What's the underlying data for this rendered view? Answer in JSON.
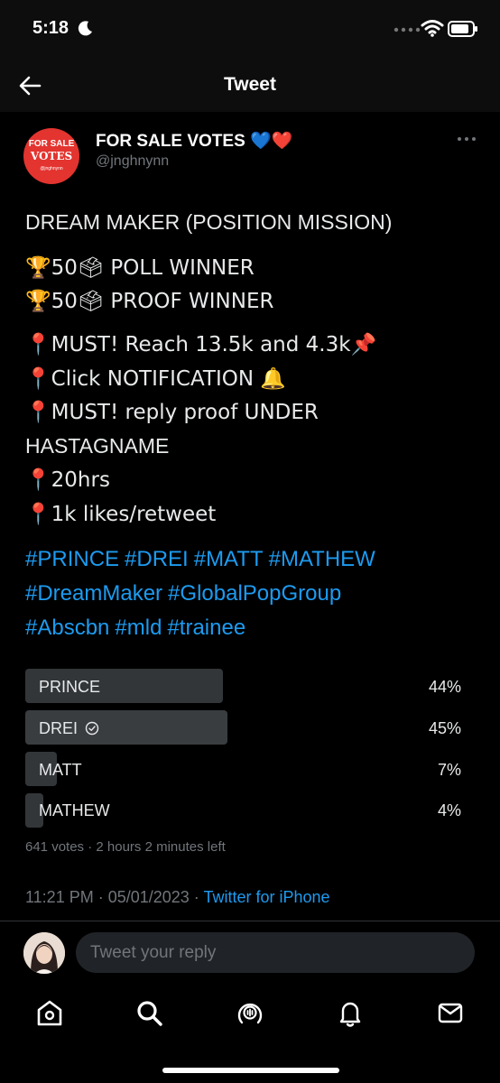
{
  "status_bar": {
    "time": "5:18"
  },
  "header": {
    "title": "Tweet"
  },
  "author": {
    "display_name": "FOR SALE VOTES 💙❤️",
    "handle": "@jnghnynn",
    "avatar_top": "FOR SALE",
    "avatar_main": "VOTES",
    "avatar_sub": "@jnghnynn"
  },
  "tweet": {
    "lines": [
      "DREAM MAKER (POSITION MISSION)",
      "🏆50🗳 POLL WINNER",
      "🏆50🗳 PROOF WINNER",
      "📍MUST! Reach 13.5k and 4.3k📌",
      "📍Click NOTIFICATION 🔔",
      "📍MUST! reply proof UNDER",
      "HASTAGNAME",
      "📍20hrs",
      "📍1k likes/retweet"
    ],
    "hashtags_line1": [
      "#PRINCE",
      "#DREI",
      "#MATT",
      "#MATHEW"
    ],
    "hashtags_line2": [
      "#DreamMaker",
      "#GlobalPopGroup"
    ],
    "hashtags_line3": [
      "#Abscbn",
      "#mld",
      "#trainee"
    ]
  },
  "poll": {
    "options": [
      {
        "label": "PRINCE",
        "percent": "44%",
        "value": 44
      },
      {
        "label": "DREI",
        "percent": "45%",
        "value": 45,
        "winner": true
      },
      {
        "label": "MATT",
        "percent": "7%",
        "value": 7
      },
      {
        "label": "MATHEW",
        "percent": "4%",
        "value": 4
      }
    ],
    "meta": "641 votes · 2 hours 2 minutes left"
  },
  "tweet_meta": {
    "time_date": "11:21 PM · 05/01/2023 · ",
    "source": "Twitter for iPhone"
  },
  "reply": {
    "placeholder": "Tweet your reply"
  },
  "tabbar": {
    "icons": [
      "home-icon",
      "search-icon",
      "spaces-icon",
      "notifications-icon",
      "messages-icon"
    ]
  },
  "colors": {
    "background": "#000000",
    "link": "#1d9bf0",
    "poll_bar": "#333639",
    "avatar_red": "#e3342f"
  }
}
